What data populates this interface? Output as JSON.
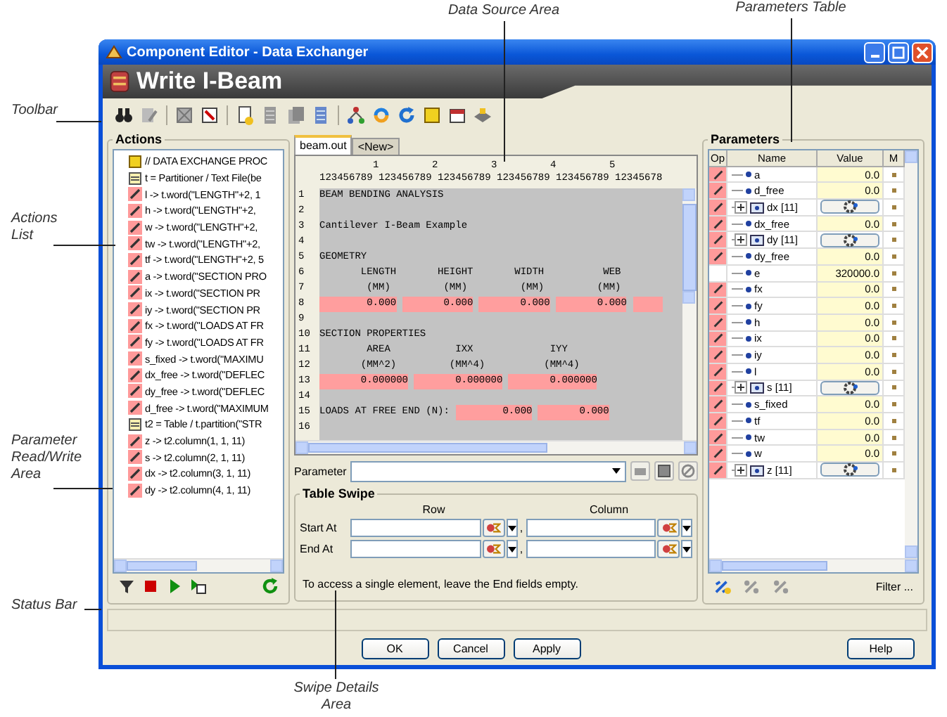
{
  "callouts": [
    {
      "text": "Data Source Area"
    },
    {
      "text": "Parameters Table"
    },
    {
      "text": "Toolbar"
    },
    {
      "text": "Actions List"
    },
    {
      "text": "Parameter Read/Write Area"
    },
    {
      "text": "Status Bar"
    },
    {
      "text": "Swipe Details Area"
    }
  ],
  "window": {
    "title": "Component Editor - Data Exchanger"
  },
  "header": {
    "title": "Write I-Beam"
  },
  "actions": {
    "title": "Actions",
    "items": [
      {
        "text": "// DATA EXCHANGE PROC",
        "kind": "comment"
      },
      {
        "text": "t = Partitioner / Text File(be",
        "kind": "partition"
      },
      {
        "text": "l -> t.word(\"LENGTH\"+2, 1",
        "kind": "assign"
      },
      {
        "text": "h -> t.word(\"LENGTH\"+2,",
        "kind": "assign"
      },
      {
        "text": "w -> t.word(\"LENGTH\"+2,",
        "kind": "assign"
      },
      {
        "text": "tw -> t.word(\"LENGTH\"+2,",
        "kind": "assign"
      },
      {
        "text": "tf -> t.word(\"LENGTH\"+2, 5",
        "kind": "assign"
      },
      {
        "text": "a -> t.word(\"SECTION PRO",
        "kind": "assign"
      },
      {
        "text": "ix -> t.word(\"SECTION PR",
        "kind": "assign"
      },
      {
        "text": "iy -> t.word(\"SECTION PR",
        "kind": "assign"
      },
      {
        "text": "fx -> t.word(\"LOADS AT FR",
        "kind": "assign"
      },
      {
        "text": "fy -> t.word(\"LOADS AT FR",
        "kind": "assign"
      },
      {
        "text": "s_fixed -> t.word(\"MAXIMU",
        "kind": "assign"
      },
      {
        "text": "dx_free -> t.word(\"DEFLEC",
        "kind": "assign"
      },
      {
        "text": "dy_free -> t.word(\"DEFLEC",
        "kind": "assign"
      },
      {
        "text": "d_free -> t.word(\"MAXIMUM",
        "kind": "assign"
      },
      {
        "text": "t2 = Table / t.partition(\"STR",
        "kind": "partition"
      },
      {
        "text": "z -> t2.column(1, 1, 11)",
        "kind": "assign"
      },
      {
        "text": "s -> t2.column(2, 1, 11)",
        "kind": "assign"
      },
      {
        "text": "dx -> t2.column(3, 1, 11)",
        "kind": "assign"
      },
      {
        "text": "dy -> t2.column(4, 1, 11)",
        "kind": "assign"
      }
    ]
  },
  "data_source": {
    "tabs": [
      {
        "label": "beam.out",
        "selected": true
      },
      {
        "label": "<New>",
        "selected": false
      }
    ],
    "ruler_tens": [
      "1",
      "2",
      "3",
      "4",
      "5"
    ],
    "ruler_units": "123456789 123456789 123456789 123456789 123456789 12345678",
    "lines": [
      {
        "number": "1",
        "segments": [
          {
            "text": "BEAM BENDING ANALYSIS",
            "field": false
          }
        ]
      },
      {
        "number": "2"
      },
      {
        "number": "3",
        "segments": [
          {
            "text": "Cantilever I-Beam Example",
            "field": false
          }
        ]
      },
      {
        "number": "4"
      },
      {
        "number": "5",
        "segments": [
          {
            "text": "GEOMETRY",
            "field": false
          }
        ]
      },
      {
        "number": "6",
        "segments": [
          {
            "text": "       LENGTH       HEIGHT       WIDTH          WEB",
            "field": false
          }
        ]
      },
      {
        "number": "7",
        "segments": [
          {
            "text": "        (MM)         (MM)         (MM)         (MM)",
            "field": false
          }
        ]
      },
      {
        "number": "8",
        "segments": [
          {
            "text": "        0.000",
            "field": true
          },
          {
            "text": "       0.000",
            "field": true
          },
          {
            "text": "       0.000",
            "field": true
          },
          {
            "text": "       0.000",
            "field": true
          },
          {
            "field": true
          }
        ]
      },
      {
        "number": "9"
      },
      {
        "number": "10",
        "segments": [
          {
            "text": "SECTION PROPERTIES",
            "field": false
          }
        ]
      },
      {
        "number": "11",
        "segments": [
          {
            "text": "        AREA           IXX             IYY",
            "field": false
          }
        ]
      },
      {
        "number": "12",
        "segments": [
          {
            "text": "       (MM^2)         (MM^4)          (MM^4)",
            "field": false
          }
        ]
      },
      {
        "number": "13",
        "segments": [
          {
            "text": "       0.000000",
            "field": true
          },
          {
            "text": "       0.000000",
            "field": true
          },
          {
            "text": "       0.000000",
            "field": true
          }
        ]
      },
      {
        "number": "14"
      },
      {
        "number": "15",
        "segments": [
          {
            "text": "LOADS AT FREE END (N):",
            "field": false
          },
          {
            "text": "        0.000",
            "field": true
          },
          {
            "text": "       0.000",
            "field": true
          }
        ]
      },
      {
        "number": "16"
      }
    ]
  },
  "parameter": {
    "label": "Parameter"
  },
  "table_swipe": {
    "title": "Table Swipe",
    "row_header": "Row",
    "column_header": "Column",
    "rows": [
      {
        "label": "Start At",
        "separator": ","
      },
      {
        "label": "End At",
        "separator": ","
      }
    ],
    "note": "To access a single element, leave the End fields empty."
  },
  "parameters": {
    "title": "Parameters",
    "columns": [
      "Op",
      "Name",
      "Value",
      "M"
    ],
    "rows": [
      {
        "name": "a",
        "kind": "scalar",
        "op": true,
        "value": "0.0"
      },
      {
        "name": "d_free",
        "kind": "scalar",
        "op": true,
        "value": "0.0"
      },
      {
        "name": "dx [11]",
        "kind": "array",
        "op": true
      },
      {
        "name": "dx_free",
        "kind": "scalar",
        "op": true,
        "value": "0.0"
      },
      {
        "name": "dy [11]",
        "kind": "array",
        "op": true
      },
      {
        "name": "dy_free",
        "kind": "scalar",
        "op": true,
        "value": "0.0"
      },
      {
        "name": "e",
        "kind": "scalar",
        "op": false,
        "value": "320000.0"
      },
      {
        "name": "fx",
        "kind": "scalar",
        "op": true,
        "value": "0.0"
      },
      {
        "name": "fy",
        "kind": "scalar",
        "op": true,
        "value": "0.0"
      },
      {
        "name": "h",
        "kind": "scalar",
        "op": true,
        "value": "0.0"
      },
      {
        "name": "ix",
        "kind": "scalar",
        "op": true,
        "value": "0.0"
      },
      {
        "name": "iy",
        "kind": "scalar",
        "op": true,
        "value": "0.0"
      },
      {
        "name": "l",
        "kind": "scalar",
        "op": true,
        "value": "0.0"
      },
      {
        "name": "s [11]",
        "kind": "array",
        "op": true
      },
      {
        "name": "s_fixed",
        "kind": "scalar",
        "op": true,
        "value": "0.0"
      },
      {
        "name": "tf",
        "kind": "scalar",
        "op": true,
        "value": "0.0"
      },
      {
        "name": "tw",
        "kind": "scalar",
        "op": true,
        "value": "0.0"
      },
      {
        "name": "w",
        "kind": "scalar",
        "op": true,
        "value": "0.0"
      },
      {
        "name": "z [11]",
        "kind": "array",
        "op": true
      }
    ],
    "filter_button": "Filter ..."
  },
  "buttons": [
    {
      "label": "OK",
      "kind": "main"
    },
    {
      "label": "Cancel",
      "kind": "main"
    },
    {
      "label": "Apply",
      "kind": "main"
    },
    {
      "label": "Help",
      "kind": "help"
    }
  ]
}
